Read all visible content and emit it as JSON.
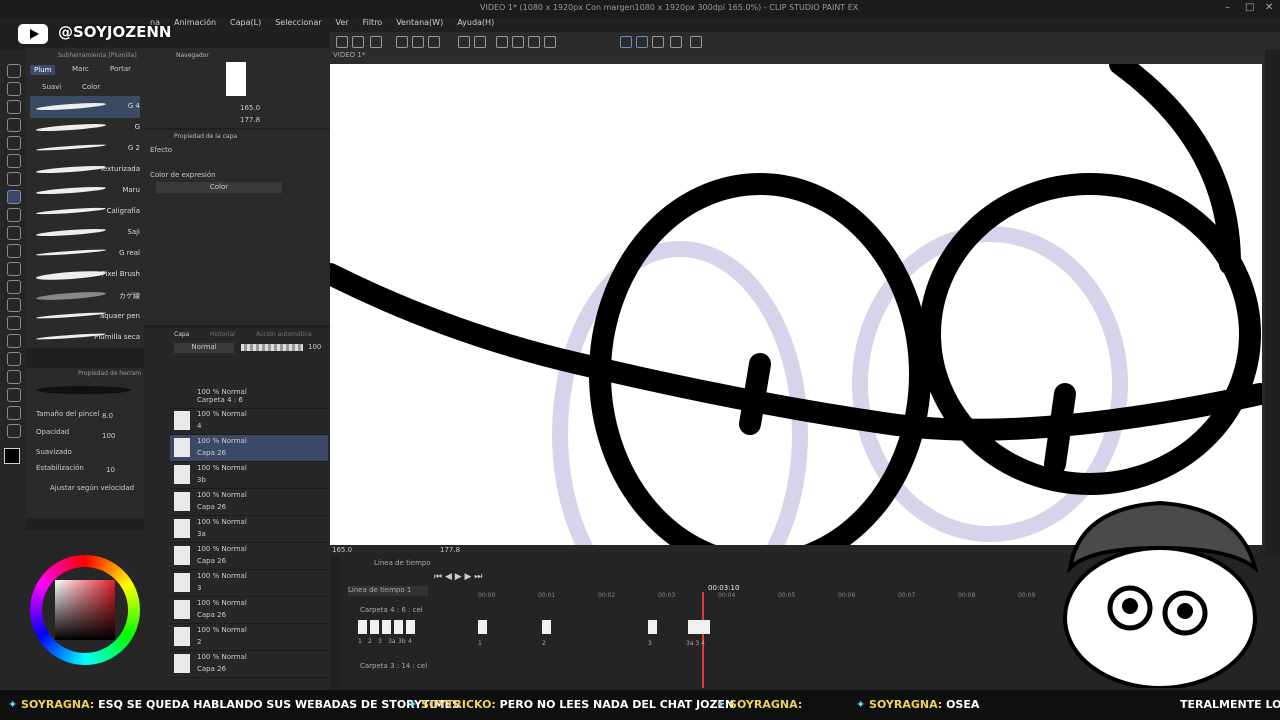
{
  "window": {
    "title": "VIDEO 1* (1080 x 1920px Con margen1080 x 1920px 300dpi 165.0%) - CLIP STUDIO PAINT EX",
    "menu": [
      "na",
      "Animación",
      "Capa(L)",
      "Seleccionar",
      "Ver",
      "Filtro",
      "Ventana(W)",
      "Ayuda(H)"
    ]
  },
  "watermark": {
    "handle": "@SOYJOZENN"
  },
  "subtool": {
    "header": "Subherramienta [Plumilla]",
    "tabs": [
      "Plum",
      "Marc",
      "Portar"
    ],
    "subtabs": [
      "Suavi",
      "Color"
    ],
    "brushes": [
      "G 4",
      "G",
      "G 2",
      "Texturizada",
      "Maru",
      "Caligrafía",
      "Saji",
      "G real",
      "Pixel Brush",
      "カゲ線",
      "aquaer pen",
      "Plumilla seca"
    ]
  },
  "toolprop": {
    "header": "Propiedad de herram",
    "rows": [
      {
        "label": "Tamaño del pincel",
        "value": "8.0"
      },
      {
        "label": "Opacidad",
        "value": "100"
      },
      {
        "label": "Suavizado",
        "value": ""
      },
      {
        "label": "Estabilización",
        "value": "10"
      },
      {
        "label": "Ajustar según velocidad",
        "value": ""
      }
    ]
  },
  "navigator": {
    "tab": "Navegador",
    "zoom": "165.0",
    "angle": "177.8"
  },
  "layerprop": {
    "tab": "Propiedad de la capa",
    "effect_label": "Efecto",
    "expr_label": "Color de expresión",
    "expr_value": "Color"
  },
  "layers": {
    "tabs": [
      "Capa",
      "Historial",
      "Acción automática"
    ],
    "blend": "Normal",
    "opacity": "100",
    "folder": {
      "line1": "100 % Normal",
      "line2": "Carpeta 4 : 6"
    },
    "rows": [
      {
        "line1": "100 % Normal",
        "line2": "4",
        "folder": true
      },
      {
        "line1": "100 % Normal",
        "line2": "Capa 26",
        "selected": true
      },
      {
        "line1": "100 % Normal",
        "line2": "3b",
        "folder": true
      },
      {
        "line1": "100 % Normal",
        "line2": "Capa 26"
      },
      {
        "line1": "100 % Normal",
        "line2": "3a",
        "folder": true
      },
      {
        "line1": "100 % Normal",
        "line2": "Capa 26"
      },
      {
        "line1": "100 % Normal",
        "line2": "3",
        "folder": true
      },
      {
        "line1": "100 % Normal",
        "line2": "Capa 26"
      },
      {
        "line1": "100 % Normal",
        "line2": "2",
        "folder": true
      },
      {
        "line1": "100 % Normal",
        "line2": "Capa 26"
      }
    ]
  },
  "canvas": {
    "tab": "VIDEO 1*",
    "status_zoom": "165.0",
    "status_angle": "177.8"
  },
  "timeline": {
    "tab": "Línea de tiempo",
    "name": "Línea de tiempo 1",
    "current": "00:03:10",
    "seconds": [
      "00:00",
      "00:01",
      "00:02",
      "00:03",
      "00:04",
      "00:05",
      "00:06",
      "00:07",
      "00:08",
      "00:09"
    ],
    "track1": "Carpeta 4 : 6 : cel",
    "track2": "Carpeta 3 : 14 : cel",
    "cel_labels": [
      "1",
      "2",
      "3",
      "3a",
      "3b",
      "4"
    ],
    "timeline_cels": [
      "1",
      "2",
      "3",
      "3a 3 4"
    ]
  },
  "ticker": {
    "messages": [
      {
        "user": "SOYRAGNA:",
        "text": "ESQ SE QUEDA HABLANDO SUS WEBADAS DE STORYTIMES"
      },
      {
        "user": "SOYTRICKO:",
        "text": "PERO NO LEES NADA DEL CHAT JOZEN"
      },
      {
        "user": "SOYRAGNA:",
        "text": ""
      },
      {
        "user": "SOYRAGNA:",
        "text": "OSEA"
      },
      {
        "user": "",
        "text": "TERALMENTE LO"
      }
    ]
  },
  "colors": {
    "accent": "#3a4a66",
    "chat_user": "#f1d25a",
    "timeline_marker": "#e23a3a"
  }
}
